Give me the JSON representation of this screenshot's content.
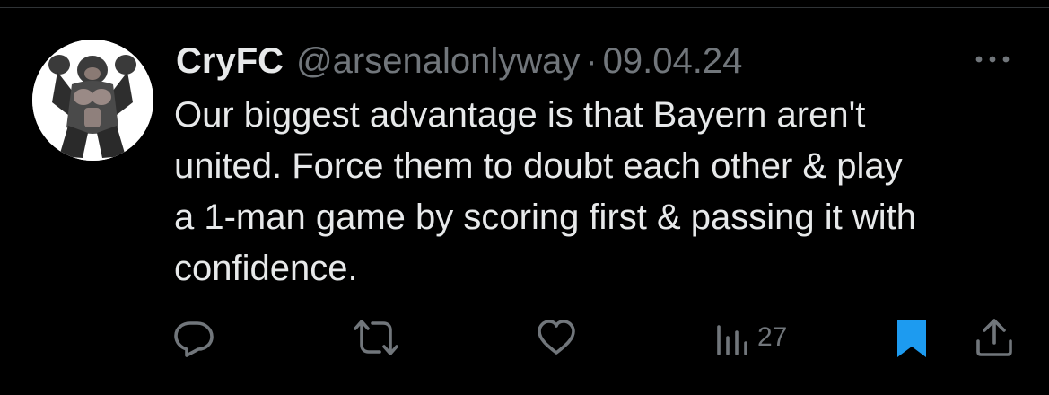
{
  "tweet": {
    "display_name": "CryFC",
    "handle": "@arsenalonlyway",
    "separator": "·",
    "date": "09.04.24",
    "text": "Our biggest advantage is that Bayern aren't\nunited. Force them to doubt each other & play\na 1-man game by scoring first & passing it with\nconfidence."
  },
  "actions": {
    "reply_icon": "reply-icon",
    "retweet_icon": "retweet-icon",
    "like_icon": "heart-icon",
    "views_icon": "views-bar-chart-icon",
    "views_count": "27",
    "bookmark_icon": "bookmark-icon",
    "share_icon": "share-icon",
    "more_icon": "more-dots-icon"
  },
  "colors": {
    "background": "#000000",
    "text_primary": "#e7e9ea",
    "text_secondary": "#71767b",
    "bookmark_active": "#1d9bf0",
    "divider": "#2f3336"
  },
  "avatar": {
    "description_icon": "gorilla-avatar-icon"
  }
}
